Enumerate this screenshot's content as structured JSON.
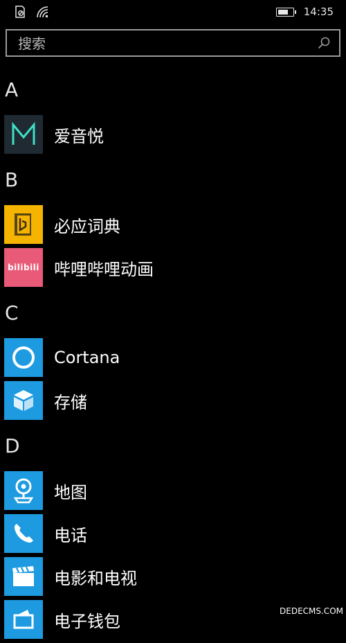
{
  "status_bar": {
    "time": "14:35",
    "icons": [
      "no-sim-icon",
      "wifi-icon",
      "battery-icon"
    ]
  },
  "search": {
    "placeholder": "搜索",
    "icon": "search-icon"
  },
  "groups": [
    {
      "letter": "A",
      "apps": [
        {
          "name": "爱音悦",
          "icon": "m-logo-icon",
          "tile_color": "#1f2a33",
          "glyph_color": "#3fe0c5"
        }
      ]
    },
    {
      "letter": "B",
      "apps": [
        {
          "name": "必应词典",
          "icon": "bing-dictionary-icon",
          "tile_color": "#f4b400",
          "glyph_color": "#4a3b1b"
        },
        {
          "name": "哔哩哔哩动画",
          "icon": "bilibili-icon",
          "tile_color": "#e95a78",
          "glyph_color": "#ffffff",
          "glyph_text": "bilibili"
        }
      ]
    },
    {
      "letter": "C",
      "apps": [
        {
          "name": "Cortana",
          "icon": "cortana-icon",
          "tile_color": "#1e9be0",
          "glyph_color": "#ffffff"
        },
        {
          "name": "存储",
          "icon": "storage-icon",
          "tile_color": "#1e9be0",
          "glyph_color": "#ffffff"
        }
      ]
    },
    {
      "letter": "D",
      "apps": [
        {
          "name": "地图",
          "icon": "maps-icon",
          "tile_color": "#1e9be0",
          "glyph_color": "#ffffff"
        },
        {
          "name": "电话",
          "icon": "phone-icon",
          "tile_color": "#1e9be0",
          "glyph_color": "#ffffff"
        },
        {
          "name": "电影和电视",
          "icon": "movies-tv-icon",
          "tile_color": "#1e9be0",
          "glyph_color": "#ffffff"
        },
        {
          "name": "电子钱包",
          "icon": "wallet-icon",
          "tile_color": "#1e9be0",
          "glyph_color": "#ffffff"
        }
      ]
    }
  ],
  "watermark": {
    "text": "DEDECMS.COM"
  }
}
